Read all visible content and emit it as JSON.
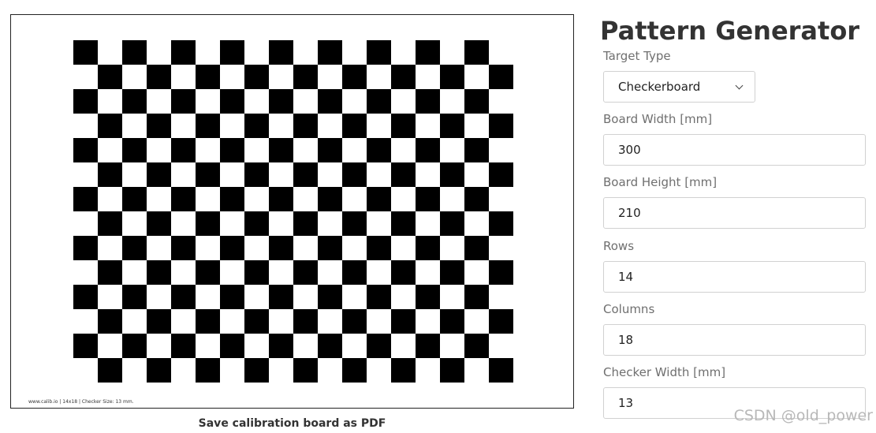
{
  "preview": {
    "footer_text": "www.calib.io | 14x18 | Checker Size: 13 mm.",
    "save_label": "Save calibration board as PDF",
    "board": {
      "rows": 14,
      "columns": 18,
      "square_color": "#000000",
      "background_color": "#ffffff"
    }
  },
  "panel": {
    "title": "Pattern Generator",
    "target_type": {
      "label": "Target Type",
      "value": "Checkerboard"
    },
    "board_width": {
      "label": "Board Width [mm]",
      "value": "300"
    },
    "board_height": {
      "label": "Board Height [mm]",
      "value": "210"
    },
    "rows": {
      "label": "Rows",
      "value": "14"
    },
    "columns": {
      "label": "Columns",
      "value": "18"
    },
    "checker_width": {
      "label": "Checker Width [mm]",
      "value": "13"
    }
  },
  "watermark": "CSDN @old_power",
  "icons": {
    "select_arrow": "chevron-down-icon"
  }
}
